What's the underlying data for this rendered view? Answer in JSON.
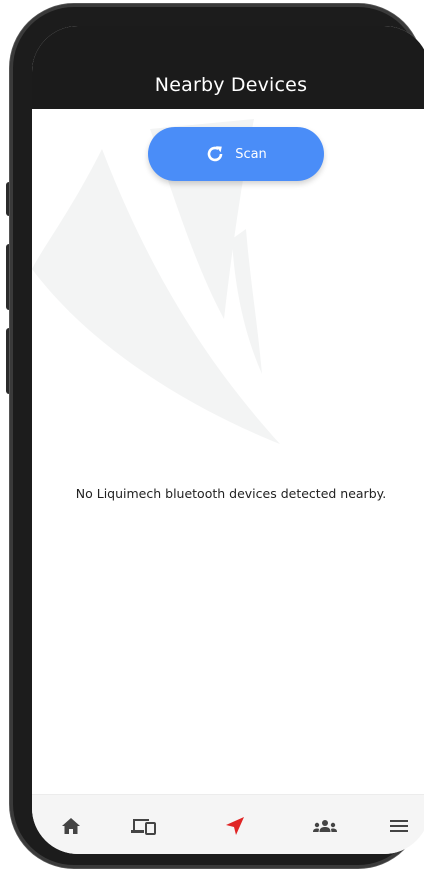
{
  "header": {
    "title": "Nearby Devices"
  },
  "scan_button": {
    "label": "Scan",
    "icon": "refresh-icon",
    "color": "#4a8df8"
  },
  "empty_state": {
    "message": "No Liquimech bluetooth devices detected nearby."
  },
  "bottom_nav": {
    "items": [
      {
        "name": "home",
        "icon": "home-icon",
        "active": false
      },
      {
        "name": "devices",
        "icon": "devices-icon",
        "active": false
      },
      {
        "name": "nearby",
        "icon": "navigation-arrow-icon",
        "active": true
      },
      {
        "name": "users",
        "icon": "group-icon",
        "active": false
      },
      {
        "name": "menu",
        "icon": "hamburger-menu-icon",
        "active": false
      }
    ],
    "active_color": "#e02424",
    "inactive_color": "#444444"
  },
  "colors": {
    "header_bg": "#1b1b1b",
    "screen_bg": "#ffffff",
    "nav_bg": "#f5f5f5"
  }
}
